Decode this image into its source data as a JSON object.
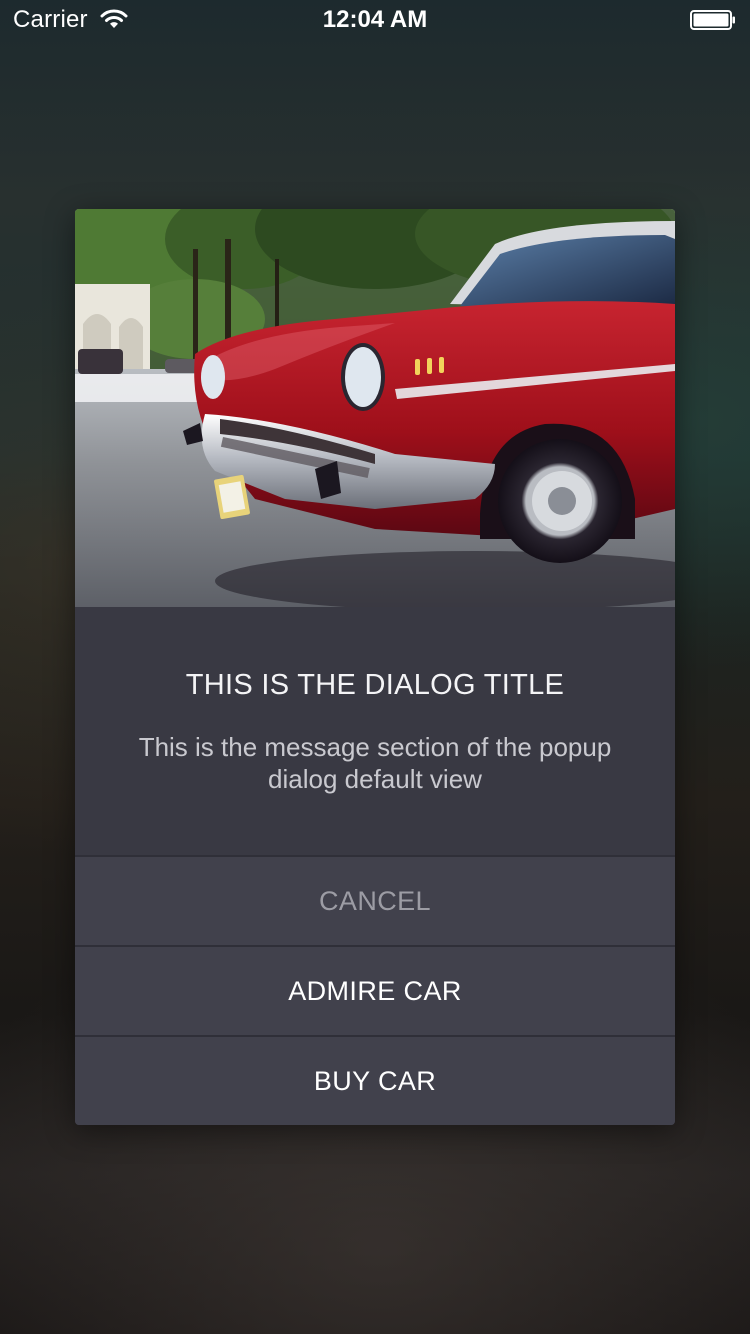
{
  "status_bar": {
    "carrier": "Carrier",
    "time": "12:04 AM",
    "icons": [
      "wifi-icon",
      "battery-icon"
    ]
  },
  "dialog": {
    "image": "red-classic-car-photo",
    "title": "THIS IS THE DIALOG TITLE",
    "message": "This is the message section of the popup dialog default view",
    "buttons": {
      "cancel": "CANCEL",
      "admire": "ADMIRE CAR",
      "buy": "BUY CAR"
    }
  },
  "colors": {
    "dialog_background": "#393943",
    "button_background": "#41414c",
    "cancel_text": "#9c9ca4",
    "primary_text": "#ffffff",
    "car_red": "#a3101a"
  }
}
